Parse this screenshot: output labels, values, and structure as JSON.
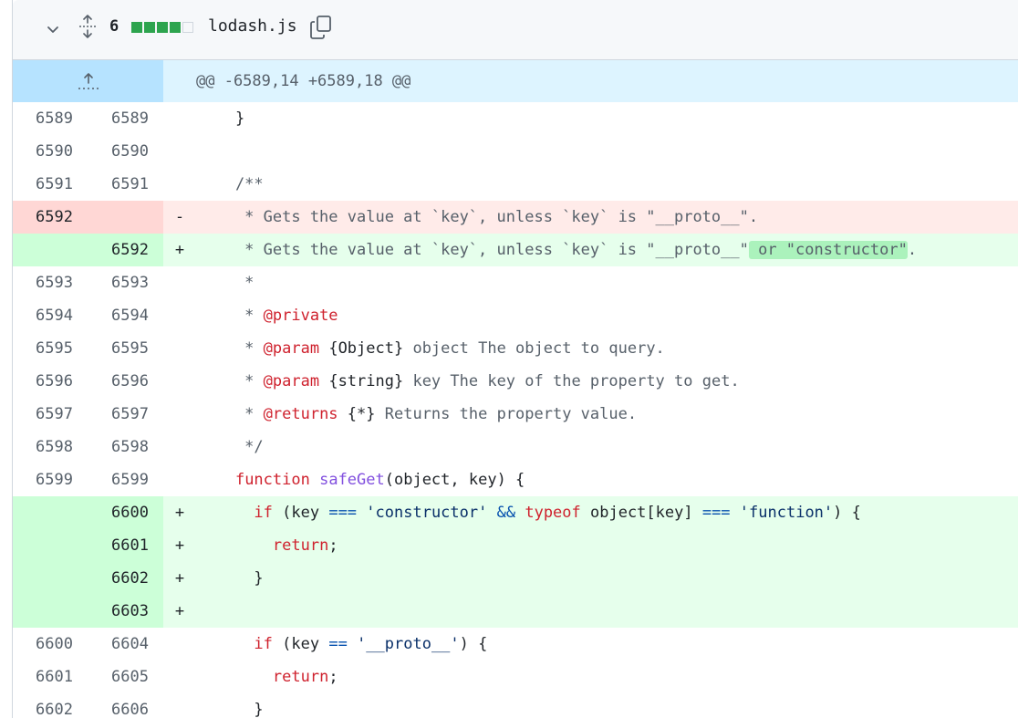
{
  "file_header": {
    "changed_count": "6",
    "diffstat": [
      "add",
      "add",
      "add",
      "add",
      "neutral"
    ],
    "filename": "lodash.js",
    "icons": [
      "chevron-down-icon",
      "unfold-icon",
      "copy-icon"
    ]
  },
  "hunk": {
    "header": "@@ -6589,14 +6589,18 @@",
    "icon": "expand-up-icon"
  },
  "lines": [
    {
      "type": "context",
      "old": "6589",
      "new": "6589",
      "marker": "",
      "text": "    }"
    },
    {
      "type": "context",
      "old": "6590",
      "new": "6590",
      "marker": "",
      "text": ""
    },
    {
      "type": "context",
      "old": "6591",
      "new": "6591",
      "marker": "",
      "text": "    /**"
    },
    {
      "type": "del",
      "old": "6592",
      "new": "",
      "marker": "-",
      "text": "     * Gets the value at `key`, unless `key` is \"__proto__\"."
    },
    {
      "type": "add",
      "old": "",
      "new": "6592",
      "marker": "+",
      "text_before": "     * Gets the value at `key`, unless `key` is \"__proto__\"",
      "text_highlight": " or \"constructor\"",
      "text_after": "."
    },
    {
      "type": "context",
      "old": "6593",
      "new": "6593",
      "marker": "",
      "text": "     *"
    },
    {
      "type": "context",
      "old": "6594",
      "new": "6594",
      "marker": "",
      "text_prefix": "     * ",
      "tag": "@private",
      "text_rest": ""
    },
    {
      "type": "context",
      "old": "6595",
      "new": "6595",
      "marker": "",
      "text_prefix": "     * ",
      "tag": "@param",
      "text_rest": " {Object} object The object to query."
    },
    {
      "type": "context",
      "old": "6596",
      "new": "6596",
      "marker": "",
      "text_prefix": "     * ",
      "tag": "@param",
      "text_rest": " {string} key The key of the property to get."
    },
    {
      "type": "context",
      "old": "6597",
      "new": "6597",
      "marker": "",
      "text_prefix": "     * ",
      "tag": "@returns",
      "text_rest": " {*} Returns the property value."
    },
    {
      "type": "context",
      "old": "6598",
      "new": "6598",
      "marker": "",
      "text": "     */"
    },
    {
      "type": "context",
      "old": "6599",
      "new": "6599",
      "marker": "",
      "kw": "function",
      "fn": "safeGet",
      "rest": "(object, key) {"
    },
    {
      "type": "add",
      "old": "",
      "new": "6600",
      "marker": "+",
      "line_a": "      if (key ",
      "op1": "===",
      "str1": "'constructor'",
      "and": "&&",
      "kw2": "typeof",
      "mid": " object[key] ",
      "op2": "===",
      "str2": "'function'",
      "end": ") {"
    },
    {
      "type": "add",
      "old": "",
      "new": "6601",
      "marker": "+",
      "kw": "return",
      "text": ";"
    },
    {
      "type": "add",
      "old": "",
      "new": "6602",
      "marker": "+",
      "text": "      }"
    },
    {
      "type": "add",
      "old": "",
      "new": "6603",
      "marker": "+",
      "text": ""
    },
    {
      "type": "context",
      "old": "6600",
      "new": "6604",
      "marker": "",
      "kw": "if",
      "before": " (key ",
      "op": "==",
      "str": "'__proto__'",
      "after": ") {"
    },
    {
      "type": "context",
      "old": "6601",
      "new": "6605",
      "marker": "",
      "kw": "return",
      "text": ";"
    },
    {
      "type": "context",
      "old": "6602",
      "new": "6606",
      "marker": "",
      "text": "      }"
    }
  ]
}
